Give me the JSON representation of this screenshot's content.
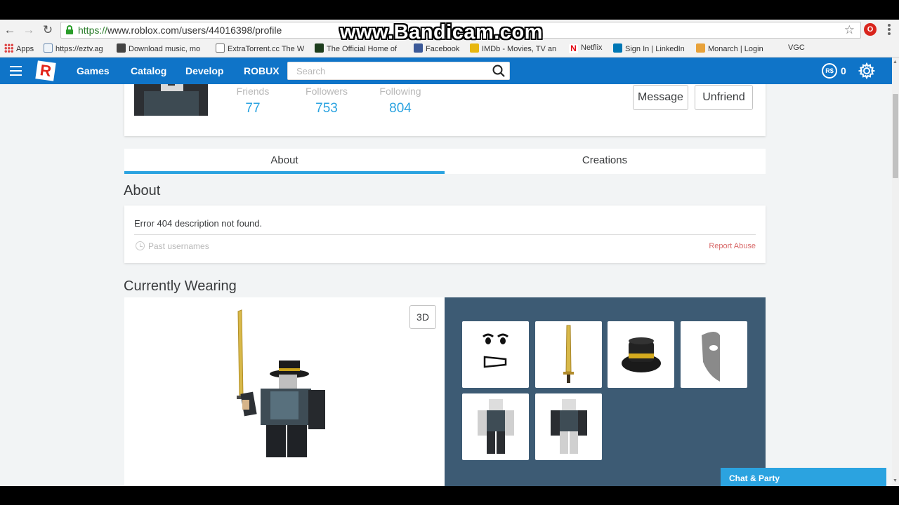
{
  "browser": {
    "url_scheme": "https://",
    "url_host": "www.roblox.com",
    "url_path": "/users/44016398/profile",
    "watermark": "www.Bandicam.com",
    "ext_badge": "O",
    "bookmarks": [
      {
        "label": "Apps"
      },
      {
        "label": "https://eztv.ag"
      },
      {
        "label": "Download music, mo"
      },
      {
        "label": "ExtraTorrent.cc The W"
      },
      {
        "label": "The Official Home of"
      },
      {
        "label": "Facebook"
      },
      {
        "label": "IMDb - Movies, TV an"
      },
      {
        "label": "Netflix"
      },
      {
        "label": "Sign In | LinkedIn"
      },
      {
        "label": "Monarch | Login"
      },
      {
        "label": "VGC"
      }
    ]
  },
  "header": {
    "nav": [
      "Games",
      "Catalog",
      "Develop",
      "ROBUX"
    ],
    "search_placeholder": "Search",
    "robux_symbol": "R$",
    "robux_count": "0"
  },
  "profile": {
    "stats": [
      {
        "label": "Friends",
        "value": "77"
      },
      {
        "label": "Followers",
        "value": "753"
      },
      {
        "label": "Following",
        "value": "804"
      }
    ],
    "message_label": "Message",
    "unfriend_label": "Unfriend"
  },
  "tabs": [
    {
      "label": "About",
      "active": true
    },
    {
      "label": "Creations",
      "active": false
    }
  ],
  "about": {
    "title": "About",
    "description": "Error 404 description not found.",
    "past_usernames": "Past usernames",
    "report_abuse": "Report Abuse"
  },
  "wearing": {
    "title": "Currently Wearing",
    "toggle_3d": "3D",
    "items": [
      "face",
      "golden-sword",
      "black-fedora-gold-band",
      "phantom-mask",
      "shirt",
      "pants"
    ]
  },
  "chat": {
    "label": "Chat & Party"
  },
  "colors": {
    "header_blue": "#0f74c8",
    "accent_blue": "#2ba3e0",
    "wearing_panel": "#3d5b74",
    "report_red": "#d86868"
  }
}
